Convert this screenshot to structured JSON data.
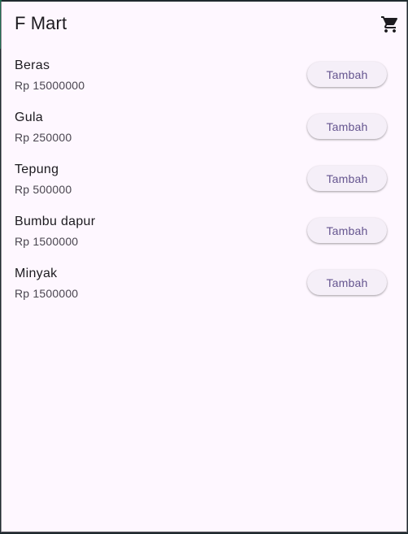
{
  "app": {
    "title": "F Mart",
    "cart_icon": "cart-icon"
  },
  "products": [
    {
      "name": "Beras",
      "price": "Rp 15000000",
      "button": "Tambah"
    },
    {
      "name": "Gula",
      "price": "Rp 250000",
      "button": "Tambah"
    },
    {
      "name": "Tepung",
      "price": "Rp 500000",
      "button": "Tambah"
    },
    {
      "name": "Bumbu dapur",
      "price": "Rp 1500000",
      "button": "Tambah"
    },
    {
      "name": "Minyak",
      "price": "Rp 1500000",
      "button": "Tambah"
    }
  ],
  "colors": {
    "background": "#fef7ff",
    "button_text": "#65558f",
    "button_bg": "#f5eff8"
  }
}
